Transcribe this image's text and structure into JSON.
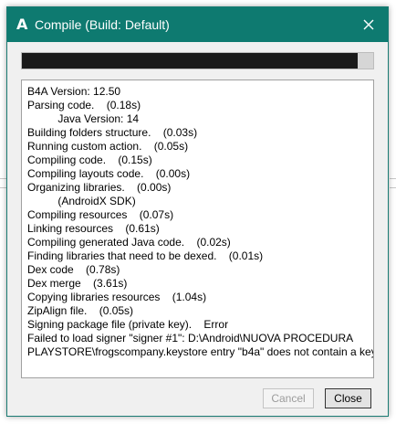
{
  "window": {
    "title": "Compile (Build: Default)",
    "app_icon_glyph": "A",
    "accent_color": "#0e7a70"
  },
  "progress": {
    "fraction": 0.956
  },
  "log": {
    "lines": [
      "B4A Version: 12.50",
      "Parsing code.    (0.18s)",
      "          Java Version: 14",
      "Building folders structure.    (0.03s)",
      "Running custom action.    (0.05s)",
      "Compiling code.    (0.15s)",
      "Compiling layouts code.    (0.00s)",
      "Organizing libraries.    (0.00s)",
      "          (AndroidX SDK)",
      "Compiling resources    (0.07s)",
      "Linking resources    (0.61s)",
      "Compiling generated Java code.    (0.02s)",
      "Finding libraries that need to be dexed.    (0.01s)",
      "Dex code    (0.78s)",
      "Dex merge    (3.61s)",
      "Copying libraries resources    (1.04s)",
      "ZipAlign file.    (0.05s)",
      "Signing package file (private key).    Error",
      "Failed to load signer \"signer #1\": D:\\Android\\NUOVA PROCEDURA",
      "PLAYSTORE\\frogscompany.keystore entry \"b4a\" does not contain a key"
    ]
  },
  "buttons": {
    "cancel_label": "Cancel",
    "close_label": "Close"
  }
}
